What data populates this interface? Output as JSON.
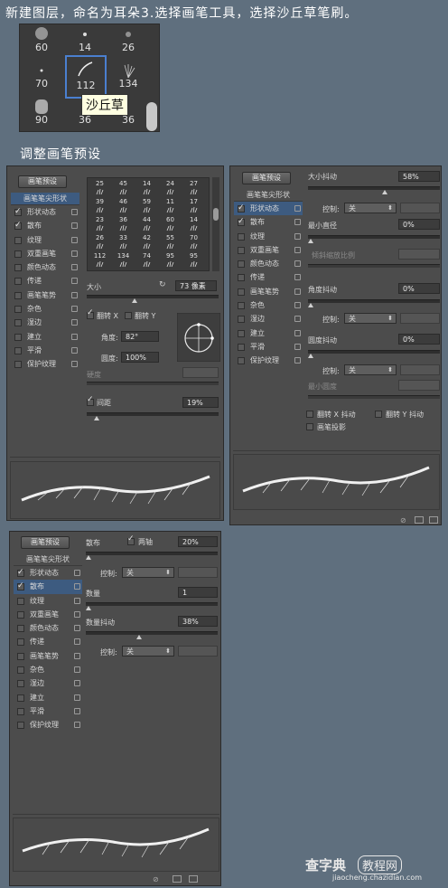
{
  "captions": {
    "top": "新建图层，命名为耳朵3.选择画笔工具，选择沙丘草笔刷。",
    "mid": "调整画笔预设"
  },
  "picker": {
    "row1": [
      "60",
      "14",
      "26"
    ],
    "row2": [
      "70",
      "112",
      "134"
    ],
    "row3": [
      "90",
      "36",
      "36"
    ],
    "tooltip": "沙丘草",
    "selected": "112"
  },
  "panel1": {
    "preset_button": "画笔预设",
    "tip_shape": "画笔笔尖形状",
    "items": [
      {
        "label": "形状动态",
        "checked": true
      },
      {
        "label": "散布",
        "checked": true
      },
      {
        "label": "纹理",
        "checked": false
      },
      {
        "label": "双重画笔",
        "checked": false
      },
      {
        "label": "颜色动态",
        "checked": false
      },
      {
        "label": "传递",
        "checked": false
      },
      {
        "label": "画笔笔势",
        "checked": false
      },
      {
        "label": "杂色",
        "checked": false
      },
      {
        "label": "湿边",
        "checked": false
      },
      {
        "label": "建立",
        "checked": false
      },
      {
        "label": "平滑",
        "checked": false
      },
      {
        "label": "保护纹理",
        "checked": false
      }
    ],
    "tile_rows": [
      [
        "25",
        "45",
        "14",
        "24",
        "27"
      ],
      [
        "39",
        "46",
        "59",
        "11",
        "17"
      ],
      [
        "23",
        "36",
        "44",
        "60",
        "14"
      ],
      [
        "26",
        "33",
        "42",
        "55",
        "70"
      ],
      [
        "112",
        "134",
        "74",
        "95",
        "95"
      ]
    ],
    "size_label": "大小",
    "size_value": "73 像素",
    "flip_x": "翻转 X",
    "flip_y": "翻转 Y",
    "angle_label": "角度:",
    "angle_value": "82°",
    "round_label": "圆度:",
    "round_value": "100%",
    "hardness_label": "硬度",
    "spacing_label": "间距",
    "spacing_value": "19%",
    "spacing_checked": true
  },
  "panel2": {
    "preset_button": "画笔预设",
    "tip_shape": "画笔笔尖形状",
    "items": [
      {
        "label": "形状动态",
        "checked": true
      },
      {
        "label": "散布",
        "checked": true
      },
      {
        "label": "纹理",
        "checked": false
      },
      {
        "label": "双重画笔",
        "checked": false
      },
      {
        "label": "颜色动态",
        "checked": false
      },
      {
        "label": "传递",
        "checked": false
      },
      {
        "label": "画笔笔势",
        "checked": false
      },
      {
        "label": "杂色",
        "checked": false
      },
      {
        "label": "湿边",
        "checked": false
      },
      {
        "label": "建立",
        "checked": false
      },
      {
        "label": "平滑",
        "checked": false
      },
      {
        "label": "保护纹理",
        "checked": false
      }
    ],
    "size_jitter_label": "大小抖动",
    "size_jitter_value": "58%",
    "control_label": "控制:",
    "control_value": "关",
    "min_diameter_label": "最小直径",
    "min_diameter_value": "0%",
    "tilt_scale_label": "倾斜缩放比例",
    "angle_jitter_label": "角度抖动",
    "angle_jitter_value": "0%",
    "roundness_jitter_label": "圆度抖动",
    "roundness_jitter_value": "0%",
    "min_roundness_label": "最小圆度",
    "flip_x_jitter": "翻转 X 抖动",
    "flip_y_jitter": "翻转 Y 抖动",
    "brush_projection": "画笔投影"
  },
  "panel3": {
    "preset_button": "画笔预设",
    "tip_shape": "画笔笔尖形状",
    "items": [
      {
        "label": "形状动态",
        "checked": true
      },
      {
        "label": "散布",
        "checked": true
      },
      {
        "label": "纹理",
        "checked": false
      },
      {
        "label": "双重画笔",
        "checked": false
      },
      {
        "label": "颜色动态",
        "checked": false
      },
      {
        "label": "传递",
        "checked": false
      },
      {
        "label": "画笔笔势",
        "checked": false
      },
      {
        "label": "杂色",
        "checked": false
      },
      {
        "label": "湿边",
        "checked": false
      },
      {
        "label": "建立",
        "checked": false
      },
      {
        "label": "平滑",
        "checked": false
      },
      {
        "label": "保护纹理",
        "checked": false
      }
    ],
    "scatter_label": "散布",
    "both_axes_label": "两轴",
    "scatter_value": "20%",
    "control_label": "控制:",
    "control_value": "关",
    "count_label": "数量",
    "count_value": "1",
    "count_jitter_label": "数量抖动",
    "count_jitter_value": "38%",
    "control2_value": "关"
  },
  "watermark": {
    "brand": "查字典",
    "badge": "教程网",
    "url": "jiaocheng.chazidian.com"
  }
}
